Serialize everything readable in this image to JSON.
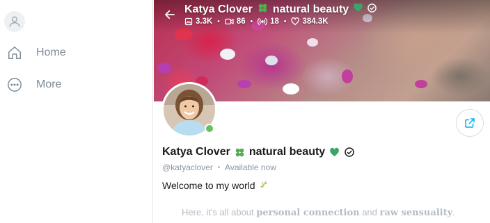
{
  "sidebar": {
    "avatar_icon": "user-icon",
    "items": [
      {
        "label": "Home",
        "icon": "home-icon"
      },
      {
        "label": "More",
        "icon": "more-circle-icon"
      }
    ]
  },
  "cover": {
    "title_name": "Katya Clover",
    "title_tag": "natural beauty",
    "stats": {
      "photos": "3.3K",
      "videos": "86",
      "streams": "18",
      "likes": "384.3K"
    }
  },
  "profile": {
    "name": "Katya Clover",
    "tag": "natural beauty",
    "handle": "@katyaclover",
    "status": "Available now",
    "welcome": "Welcome to my world",
    "bio_start": "Here, it's all about",
    "bio_bold1": "personal connection",
    "bio_mid": "and",
    "bio_bold2": "raw sensuality",
    "bio_end": "."
  },
  "colors": {
    "accent": "#00aff0",
    "online": "#67c159",
    "muted": "#8a96a3",
    "heart": "#3aa56a"
  }
}
